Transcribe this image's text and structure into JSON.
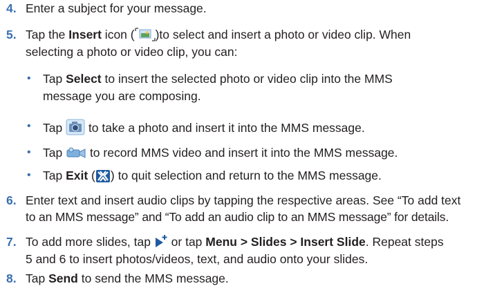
{
  "steps": [
    {
      "num": "4.",
      "text": "Enter a subject for your message."
    },
    {
      "num": "5.",
      "a": "Tap the ",
      "b": "Insert",
      "c": " icon (",
      "d": ")to select and insert a photo or video clip. When",
      "line2": "selecting a photo or video clip, you can:"
    },
    {
      "num": "6.",
      "line1": "Enter text and insert audio clips by tapping the respective areas. See “To add text",
      "line2": "to an MMS message” and “To add an audio clip to an MMS message” for details."
    },
    {
      "num": "7.",
      "a": "To add more slides, tap ",
      "b": " or tap ",
      "bold1": "Menu > Slides > Insert Slide",
      "c": ". Repeat steps",
      "line2": "5 and 6 to insert photos/videos, text, and audio onto your slides."
    },
    {
      "num": "8.",
      "a": "Tap ",
      "bold": "Send",
      "b": " to send the MMS message."
    }
  ],
  "bullets": [
    {
      "mark": "•",
      "a": "Tap ",
      "bold": "Select",
      "b": " to insert the selected photo or video clip into the MMS",
      "line2": "message you are composing."
    },
    {
      "mark": "•",
      "a": "Tap ",
      "b": " to take a photo and insert it into the MMS message."
    },
    {
      "mark": "•",
      "a": "Tap ",
      "b": " to record MMS video and insert it into the MMS message."
    },
    {
      "mark": "•",
      "a": "Tap ",
      "bold": "Exit",
      "b": " (",
      "c": ") to quit selection and return to the MMS message."
    }
  ],
  "icons": {
    "insert": "insert-picture-icon",
    "camera": "camera-icon",
    "video": "video-camera-icon",
    "exit": "exit-icon",
    "add_slide": "add-slide-icon"
  }
}
